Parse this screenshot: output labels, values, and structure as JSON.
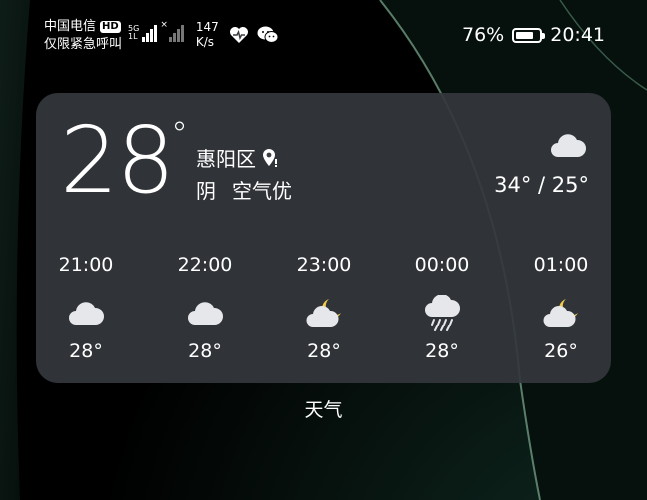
{
  "status": {
    "carrier": "中国电信",
    "hd": "HD",
    "carrier_sub": "仅限紧急呼叫",
    "net_type_top": "5G",
    "net_type_bottom": "1L",
    "no_sim_mark": "×",
    "speed_value": "147",
    "speed_unit": "K/s",
    "battery_percent": "76%",
    "battery_level": 0.76,
    "time": "20:41"
  },
  "widget": {
    "current_temp": "28",
    "degree_symbol": "°",
    "location": "惠阳区",
    "condition": "阴",
    "air_quality": "空气优",
    "high_low": "34° / 25°",
    "current_icon": "cloud-icon",
    "hourly": [
      {
        "time": "21:00",
        "icon": "cloud-icon",
        "temp": "28°"
      },
      {
        "time": "22:00",
        "icon": "cloud-icon",
        "temp": "28°"
      },
      {
        "time": "23:00",
        "icon": "cloudy-night-icon",
        "temp": "28°"
      },
      {
        "time": "00:00",
        "icon": "rain-icon",
        "temp": "28°"
      },
      {
        "time": "01:00",
        "icon": "cloudy-night-icon",
        "temp": "26°"
      }
    ]
  },
  "app_label": "天气"
}
